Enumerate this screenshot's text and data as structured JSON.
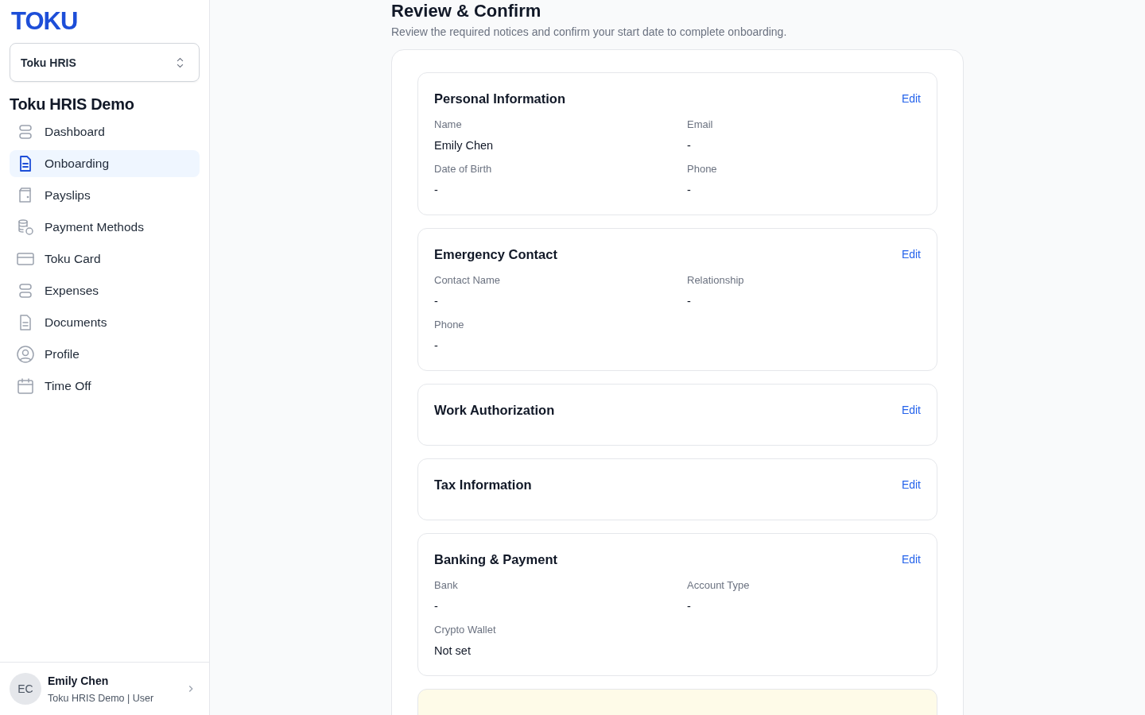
{
  "sidebar": {
    "logo": "TOKU",
    "workspace_select": {
      "value": "Toku HRIS"
    },
    "org_name": "Toku HRIS Demo",
    "items": [
      {
        "label": "Dashboard",
        "selected": false
      },
      {
        "label": "Onboarding",
        "selected": true
      },
      {
        "label": "Payslips",
        "selected": false
      },
      {
        "label": "Payment Methods",
        "selected": false
      },
      {
        "label": "Toku Card",
        "selected": false
      },
      {
        "label": "Expenses",
        "selected": false
      },
      {
        "label": "Documents",
        "selected": false
      },
      {
        "label": "Profile",
        "selected": false
      },
      {
        "label": "Time Off",
        "selected": false
      }
    ],
    "user": {
      "initials": "EC",
      "name": "Emily Chen",
      "subtitle": "Toku HRIS Demo | User"
    }
  },
  "page": {
    "title": "Review & Confirm",
    "subtitle": "Review the required notices and confirm your start date to complete onboarding."
  },
  "sections": [
    {
      "title": "Personal Information",
      "action": "Edit",
      "fields": [
        {
          "label": "Name",
          "value": "Emily Chen"
        },
        {
          "label": "Email",
          "value": "-"
        },
        {
          "label": "Date of Birth",
          "value": "-"
        },
        {
          "label": "Phone",
          "value": "-"
        }
      ]
    },
    {
      "title": "Emergency Contact",
      "action": "Edit",
      "fields": [
        {
          "label": "Contact Name",
          "value": "-"
        },
        {
          "label": "Relationship",
          "value": "-"
        },
        {
          "label": "Phone",
          "value": "-"
        }
      ]
    },
    {
      "title": "Work Authorization",
      "action": "Edit"
    },
    {
      "title": "Tax Information",
      "action": "Edit"
    },
    {
      "title": "Banking & Payment",
      "action": "Edit",
      "fields": [
        {
          "label": "Bank",
          "value": "-"
        },
        {
          "label": "Account Type",
          "value": "-"
        },
        {
          "label": "Crypto Wallet",
          "value": "Not set"
        }
      ]
    }
  ],
  "notice_card": {
    "kind": "warning"
  }
}
